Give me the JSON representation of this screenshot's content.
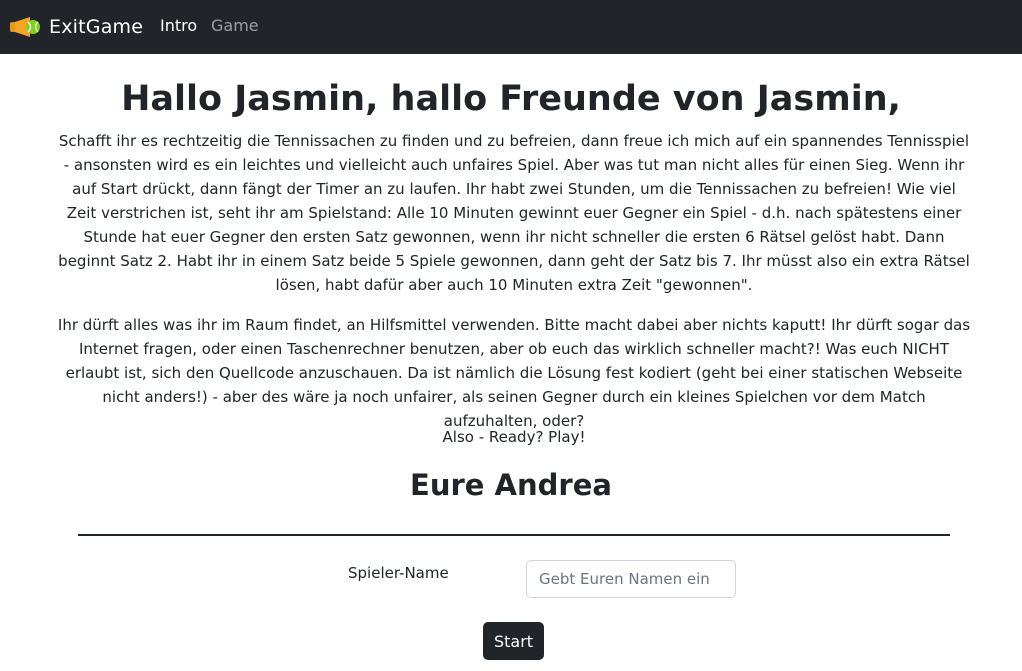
{
  "navbar": {
    "brand": "ExitGame",
    "brand_icon": "tennis-ball-logo-icon",
    "links": [
      {
        "label": "Intro",
        "active": true
      },
      {
        "label": "Game",
        "active": false
      }
    ]
  },
  "main": {
    "title": "Hallo Jasmin, hallo Freunde von Jasmin,",
    "paragraphs": [
      "Schafft ihr es rechtzeitig die Tennissachen zu finden und zu befreien, dann freue ich mich auf ein spannendes Tennisspiel - ansonsten wird es ein leichtes und vielleicht auch unfaires Spiel. Aber was tut man nicht alles für einen Sieg. Wenn ihr auf Start drückt, dann fängt der Timer an zu laufen. Ihr habt zwei Stunden, um die Tennissachen zu befreien! Wie viel Zeit verstrichen ist, seht ihr am Spielstand: Alle 10 Minuten gewinnt euer Gegner ein Spiel - d.h. nach spätestens einer Stunde hat euer Gegner den ersten Satz gewonnen, wenn ihr nicht schneller die ersten 6 Rätsel gelöst habt. Dann beginnt Satz 2. Habt ihr in einem Satz beide 5 Spiele gewonnen, dann geht der Satz bis 7. Ihr müsst also ein extra Rätsel lösen, habt dafür aber auch 10 Minuten extra Zeit \"gewonnen\".",
      "Ihr dürft alles was ihr im Raum findet, an Hilfsmittel verwenden. Bitte macht dabei aber nichts kaputt! Ihr dürft sogar das Internet fragen, oder einen Taschenrechner benutzen, aber ob euch das wirklich schneller macht?! Was euch NICHT erlaubt ist, sich den Quellcode anzuschauen. Da ist nämlich die Lösung fest kodiert (geht bei einer statischen Webseite nicht anders!) - aber des wäre ja noch unfairer, als seinen Gegner durch ein kleines Spielchen vor dem Match aufzuhalten, oder?",
      "Also - Ready? Play!"
    ],
    "signature": "Eure Andrea"
  },
  "form": {
    "name_label": "Spieler-Name",
    "name_placeholder": "Gebt Euren Namen ein",
    "name_value": "",
    "start_label": "Start"
  },
  "colors": {
    "navbar_bg": "#212529",
    "logo_orange": "#f5a623",
    "logo_green": "#7ed321"
  }
}
